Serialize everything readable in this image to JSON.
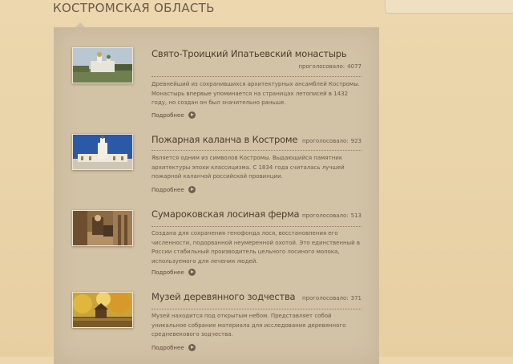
{
  "header": {
    "region_title": "КОСТРОМСКАЯ ОБЛАСТЬ"
  },
  "colors": {
    "background": "#ecd7ae",
    "panel": "#d2c2a6",
    "text": "#5a4a3a"
  },
  "places": [
    {
      "name": "Свято-Троицкий Ипатьевский монастырь",
      "votes_label": "проголосовало:",
      "votes": "4077",
      "description": "Древнейший из сохранившихся архитектурных ансамблей Костромы. Монастырь впервые упоминается на страницах летописей в 1432 году, но создан он был значительно раньше.",
      "more_label": "Подробнее",
      "thumb_icon": "monastery-photo"
    },
    {
      "name": "Пожарная каланча в Костроме",
      "votes_label": "проголосовало:",
      "votes": "923",
      "description": "Является одним из символов Костромы. Выдающийся памятник архитектуры эпохи классицизма. С 1834 года считалась лучшей пожарной каланчой российской провинции.",
      "more_label": "Подробнее",
      "thumb_icon": "fire-tower-photo"
    },
    {
      "name": "Сумароковская лосиная ферма",
      "votes_label": "проголосовало:",
      "votes": "513",
      "description": "Создана для сохранения генофонда лося, восстановления его численности, подорванной неумеренной охотой. Это единственный в России стабильный производитель цельного лосиного молока, используемого для лечения людей.",
      "more_label": "Подробнее",
      "thumb_icon": "elk-farm-photo"
    },
    {
      "name": "Музей деревянного зодчества",
      "votes_label": "проголосовало:",
      "votes": "371",
      "description": "Музей находится под открытым небом. Представляет собой уникальное собрание материала для исследования деревянного средневекового зодчества.",
      "more_label": "Подробнее",
      "thumb_icon": "wooden-museum-photo"
    }
  ]
}
